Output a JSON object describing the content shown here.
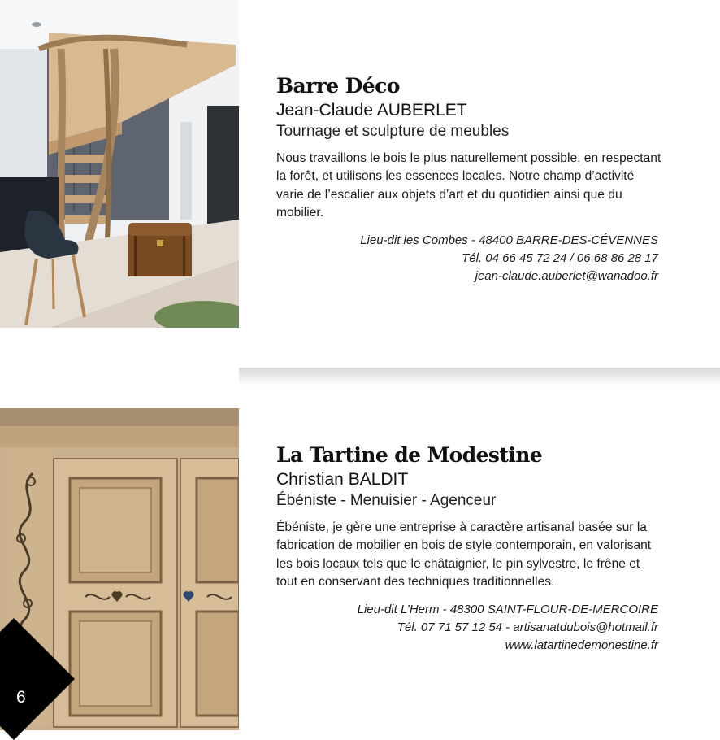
{
  "entries": [
    {
      "name": "Barre Déco",
      "person": "Jean-Claude AUBERLET",
      "trade": "Tournage et sculpture de meubles",
      "description": "Nous travaillons le bois le plus naturellement possible, en respectant la forêt, et utilisons les essences locales. Notre champ d’activité varie de l’escalier aux objets d’art et du quotidien ainsi que du mobilier.",
      "address": "Lieu-dit les Combes - 48400 BARRE-DES-CÉVENNES",
      "phone": "Tél. 04 66 45 72 24 / 06 68 86 28 17",
      "email": "jean-claude.auberlet@wanadoo.fr"
    },
    {
      "name": "La Tartine de Modestine",
      "person": "Christian BALDIT",
      "trade": "Ébéniste - Menuisier - Agenceur",
      "description": "Ébéniste, je gère une entreprise à caractère artisanal basée sur la fabrication de mobilier en bois de style contemporain, en valorisant les bois locaux tels que le châtaignier, le pin sylvestre, le frêne et tout en conservant des techniques traditionnelles.",
      "address": "Lieu-dit L’Herm - 48300 SAINT-FLOUR-DE-MERCOIRE",
      "phone_email": "Tél. 07 71 57 12 54 - artisanatdubois@hotmail.fr",
      "website": "www.latartinedemonestine.fr"
    }
  ],
  "page_number": "6"
}
